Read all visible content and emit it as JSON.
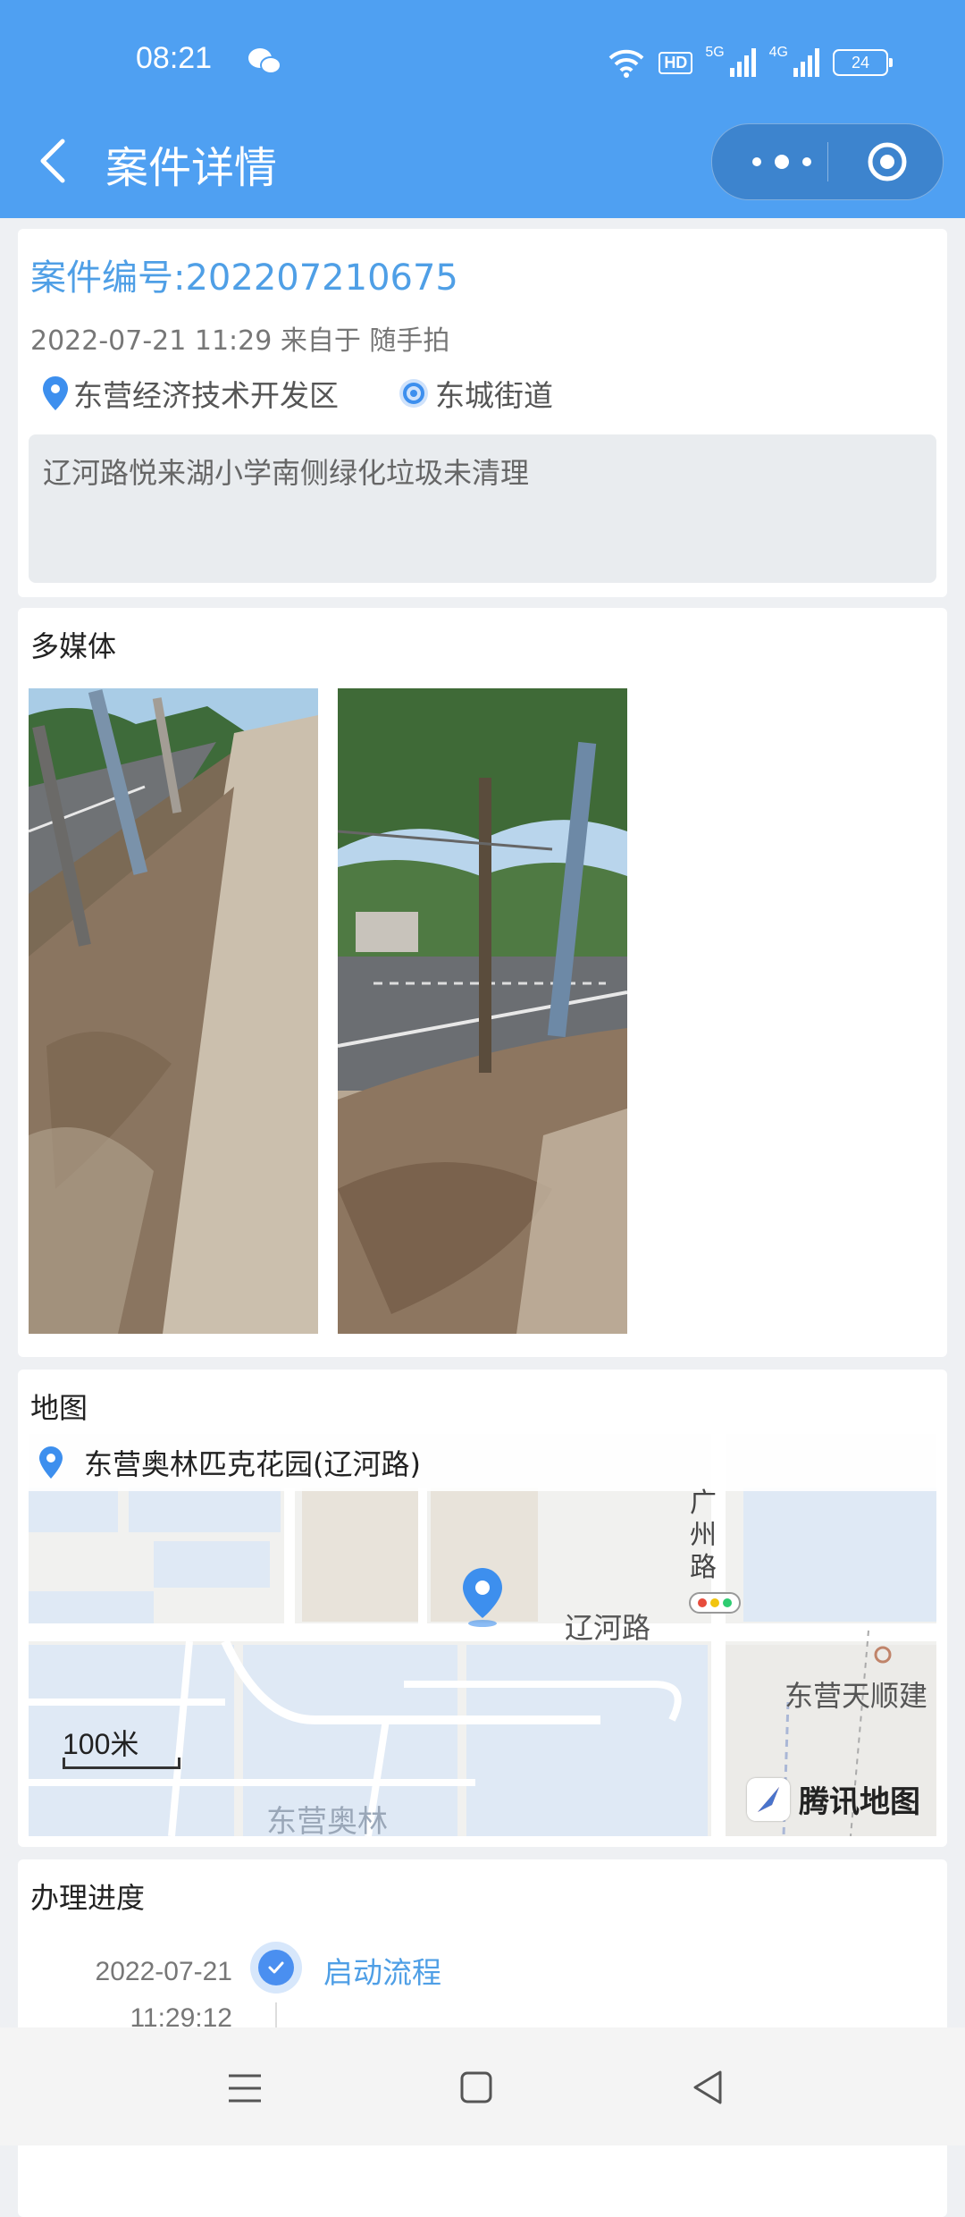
{
  "status_bar": {
    "time": "08:21",
    "hd": "HD",
    "net1": "5G",
    "net2": "4G",
    "battery": "24"
  },
  "header": {
    "title": "案件详情"
  },
  "case": {
    "number_label": "案件编号:202207210675",
    "meta": "2022-07-21 11:29 来自于 随手拍",
    "district": "东营经济技术开发区",
    "street": "东城街道",
    "description": "辽河路悦来湖小学南侧绿化垃圾未清理"
  },
  "media": {
    "title": "多媒体"
  },
  "map": {
    "title": "地图",
    "location": "东营奥林匹克花园(辽河路)",
    "scale": "100米",
    "road_label": "辽河路",
    "road_vertical": "广州路",
    "label_right": "东营天顺建",
    "label_bottom": "东营奥林",
    "brand": "腾讯地图"
  },
  "progress": {
    "title": "办理进度",
    "steps": [
      {
        "date": "2022-07-21",
        "time": "11:29:12",
        "label": "启动流程"
      }
    ]
  },
  "colors": {
    "accent": "#4fa0f2",
    "link": "#4f9fe6"
  }
}
